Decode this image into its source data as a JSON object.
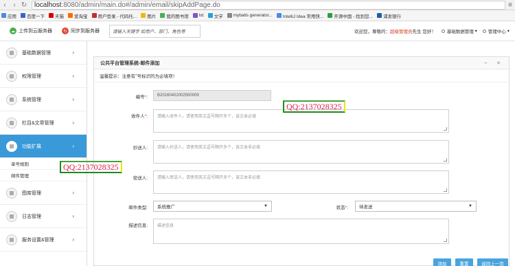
{
  "browser": {
    "url_host": "localhost",
    "url_path": ":8080/admin/main.do#/admin/email/skipAddPage.do",
    "bookmarks": [
      {
        "label": "应用",
        "color": "#4f87e8"
      },
      {
        "label": "百度一下",
        "color": "#3366cc"
      },
      {
        "label": "天猫",
        "color": "#d40000"
      },
      {
        "label": "爱淘宝",
        "color": "#ff6a00"
      },
      {
        "label": "用户登录 - 代码托...",
        "color": "#c23030"
      },
      {
        "label": "图片",
        "color": "#f2b705"
      },
      {
        "label": "我的图书馆",
        "color": "#4caf50"
      },
      {
        "label": "txt",
        "color": "#7e57c2"
      },
      {
        "label": "文学",
        "color": "#29a0d8"
      },
      {
        "label": "mybatis generator...",
        "color": "#888888"
      },
      {
        "label": "IntelliJ Idea 常用快...",
        "color": "#4f87e8"
      },
      {
        "label": "开源中国 - 找到您...",
        "color": "#2e9e3e"
      },
      {
        "label": "浦发银行",
        "color": "#1f5fa8"
      }
    ]
  },
  "header": {
    "upload_label": "上传到云服务器",
    "sync_label": "同步到服务器",
    "search_placeholder": "请输入关键字 如用户、部门、角色等",
    "welcome_prefix": "欢迎您，尊敬的：",
    "welcome_user": "超级管理员",
    "welcome_suffix": "先生 您好！",
    "menu_basic": "基础数据管理",
    "menu_admin": "管理中心"
  },
  "sidebar": {
    "items": [
      {
        "label": "基础数据管理"
      },
      {
        "label": "权限管理"
      },
      {
        "label": "系统管理"
      },
      {
        "label": "栏目&文章管理"
      },
      {
        "label": "功能扩展"
      }
    ],
    "sub_items": [
      {
        "label": "单号规则"
      },
      {
        "label": "邮件管理"
      }
    ],
    "items_after": [
      {
        "label": "图库管理"
      },
      {
        "label": "日志管理"
      },
      {
        "label": "服务设置&管理"
      }
    ]
  },
  "panel": {
    "title": "公共平台管理系统-邮件添加",
    "tools": "− ✕",
    "tip_prefix": "温馨提示：注意有",
    "tip_star": "*",
    "tip_suffix": "号标识的为必填项！",
    "fields": {
      "number_label": "编号",
      "number_value": "B20160402002500009",
      "recipient_label": "收件人",
      "recipient_placeholder": "请输入收件人，请使用英文逗号隔开多个，该文本必填",
      "cc_label": "抄送人",
      "cc_placeholder": "请输入抄送人，请使用英文逗号隔开多个，该文本非必填",
      "bcc_label": "密送人",
      "bcc_placeholder": "请输入密送人，请使用英文逗号隔开多个，该文本非必填",
      "type_label": "邮件类型",
      "type_value": "系统推广",
      "status_label": "状态",
      "status_value": "待发送",
      "desc_label": "描述信息",
      "desc_placeholder": "描述信息"
    },
    "buttons": {
      "add": "添加",
      "reset": "重置",
      "back": "返回上一页"
    }
  },
  "watermarks": {
    "qq_text": "QQ:2137028325"
  },
  "colors": {
    "accent": "#3a99d8",
    "required": "#e0301e",
    "button": "#4aa3df"
  }
}
